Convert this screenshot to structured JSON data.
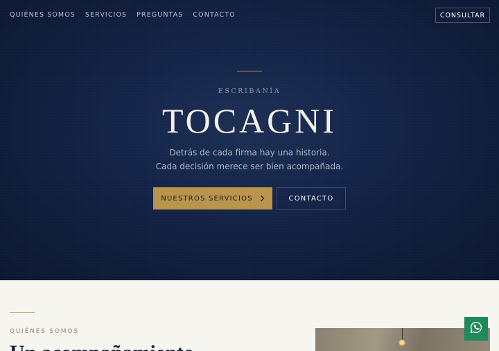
{
  "nav": {
    "items": [
      {
        "label": "QUIÉNES SOMOS"
      },
      {
        "label": "SERVICIOS"
      },
      {
        "label": "PREGUNTAS"
      },
      {
        "label": "CONTACTO"
      }
    ],
    "cta_label": "CONSULTAR"
  },
  "hero": {
    "eyebrow": "ESCRIBANÍA",
    "title": "TOCAGNI",
    "tagline_line1": "Detrás de cada firma hay una historia.",
    "tagline_line2": "Cada decisión merece ser bien acompañada.",
    "primary_button": "NUESTROS SERVICIOS",
    "primary_button_icon": "chevron-right-icon",
    "secondary_button": "CONTACTO"
  },
  "about": {
    "eyebrow": "QUIÉNES SOMOS",
    "heading_partial": "Un acompañamiento"
  },
  "floating": {
    "icon": "whatsapp-icon"
  },
  "colors": {
    "hero_bg": "#15254a",
    "gold_accent": "#b8944d",
    "cream_bg": "#f7f5f0",
    "whatsapp_green": "#1f8a5a"
  }
}
